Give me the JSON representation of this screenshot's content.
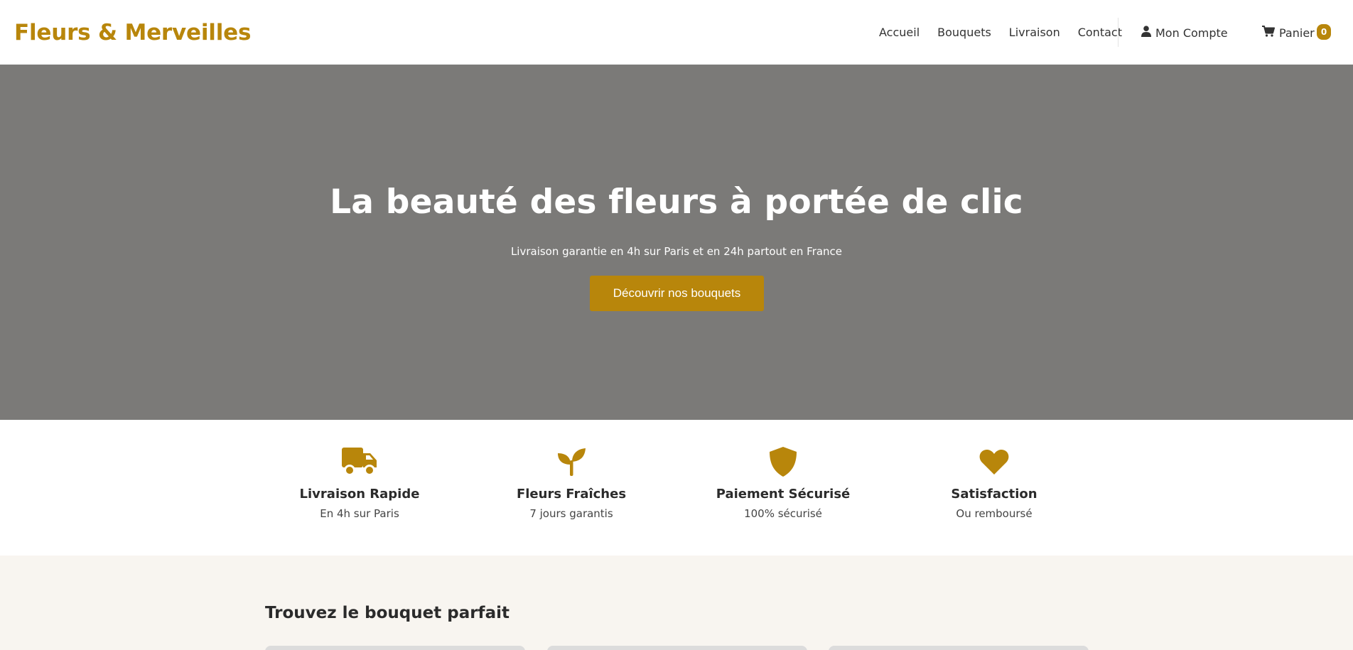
{
  "brand": {
    "name": "Fleurs & Merveilles",
    "color": "#b8860b"
  },
  "nav": {
    "links": [
      "Accueil",
      "Bouquets",
      "Livraison",
      "Contact"
    ],
    "account_label": "Mon Compte",
    "account_icon": "user-icon",
    "cart_label": "Panier",
    "cart_icon": "cart-icon",
    "cart_count": "0"
  },
  "hero": {
    "title": "La beauté des fleurs à portée de clic",
    "subtitle": "Livraison garantie en 4h sur Paris et en 24h partout en France",
    "cta_label": "Découvrir nos bouquets",
    "background_color": "#7b7a78"
  },
  "features": [
    {
      "icon": "truck-icon",
      "title": "Livraison Rapide",
      "subtitle": "En 4h sur Paris"
    },
    {
      "icon": "seedling-icon",
      "title": "Fleurs Fraîches",
      "subtitle": "7 jours garantis"
    },
    {
      "icon": "shield-icon",
      "title": "Paiement Sécurisé",
      "subtitle": "100% sécurisé"
    },
    {
      "icon": "heart-icon",
      "title": "Satisfaction",
      "subtitle": "Ou remboursé"
    }
  ],
  "finder": {
    "title": "Trouvez le bouquet parfait"
  }
}
